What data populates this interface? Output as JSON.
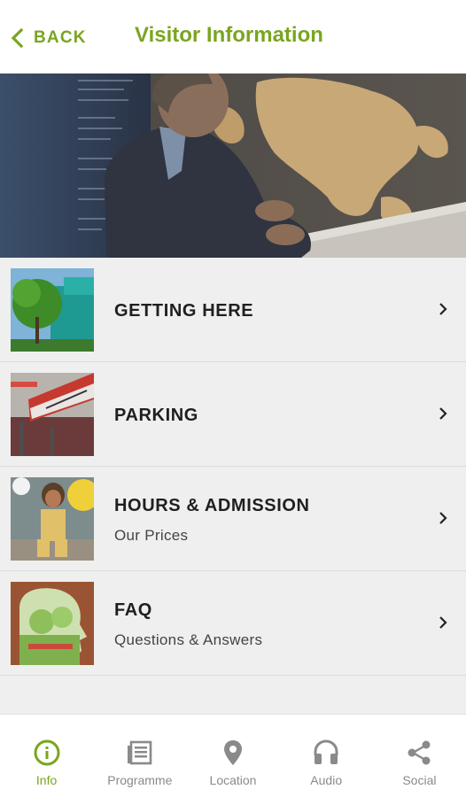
{
  "header": {
    "back_label": "BACK",
    "title": "Visitor Information"
  },
  "menu": [
    {
      "title": "GETTING HERE",
      "subtitle": "",
      "thumb": "museum-building-photo"
    },
    {
      "title": "PARKING",
      "subtitle": "",
      "thumb": "neanderthal-sign-photo"
    },
    {
      "title": "HOURS & ADMISSION",
      "subtitle": "Our Prices",
      "thumb": "child-figure-photo"
    },
    {
      "title": "FAQ",
      "subtitle": "Questions & Answers",
      "thumb": "head-silhouette-photo"
    }
  ],
  "tabs": [
    {
      "label": "Info",
      "icon": "info-icon",
      "active": true
    },
    {
      "label": "Programme",
      "icon": "newspaper-icon",
      "active": false
    },
    {
      "label": "Location",
      "icon": "location-pin-icon",
      "active": false
    },
    {
      "label": "Audio",
      "icon": "headphones-icon",
      "active": false
    },
    {
      "label": "Social",
      "icon": "share-icon",
      "active": false
    }
  ],
  "colors": {
    "accent": "#7aa51f",
    "inactive": "#8a8a8a",
    "list_background": "#efefef"
  }
}
